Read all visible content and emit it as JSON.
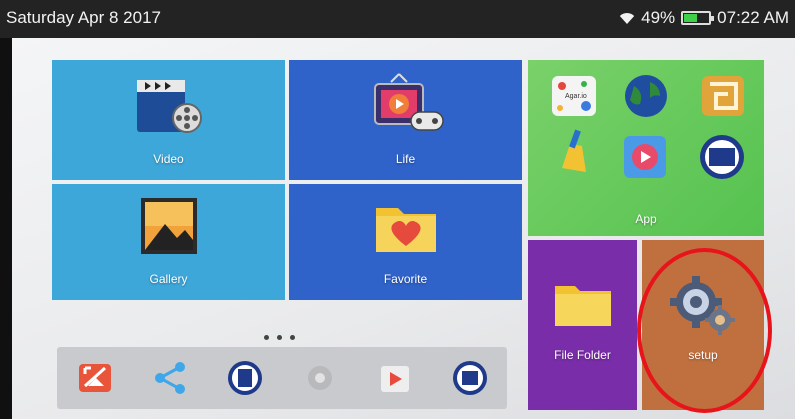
{
  "status_bar": {
    "date": "Saturday Apr 8 2017",
    "battery_percent": "49%",
    "battery_level": 0.49,
    "time": "07:22 AM",
    "icons": [
      "wifi-icon",
      "battery-icon"
    ]
  },
  "tiles": {
    "video": {
      "label": "Video",
      "icon": "video-player-icon",
      "color": "#3ea7d9"
    },
    "life": {
      "label": "Life",
      "icon": "tv-gamepad-icon",
      "color": "#2f63c9"
    },
    "gallery": {
      "label": "Gallery",
      "icon": "gallery-image-icon",
      "color": "#3ea7d9"
    },
    "favorite": {
      "label": "Favorite",
      "icon": "heart-folder-icon",
      "color": "#2f63c9"
    },
    "app": {
      "label": "App",
      "color": "#5fc655",
      "app_icons": [
        "agar-io-icon",
        "globe-icon",
        "maze-game-icon",
        "broom-cleaner-icon",
        "video-app-icon",
        "folder-app-icon"
      ],
      "app_icon_text": [
        "Agar.io"
      ]
    },
    "file_folder": {
      "label": "File Folder",
      "icon": "folder-icon",
      "color": "#7a2da8"
    },
    "setup": {
      "label": "setup",
      "icon": "gear-icon",
      "color": "#c0703e"
    }
  },
  "dock": {
    "icons": [
      "cast-off-icon",
      "share-icon",
      "film-icon",
      "settings-gear-icon",
      "play-store-icon",
      "folder-icon"
    ]
  },
  "page_indicator": {
    "pages": 3
  },
  "annotation": {
    "color": "#e8141c"
  }
}
